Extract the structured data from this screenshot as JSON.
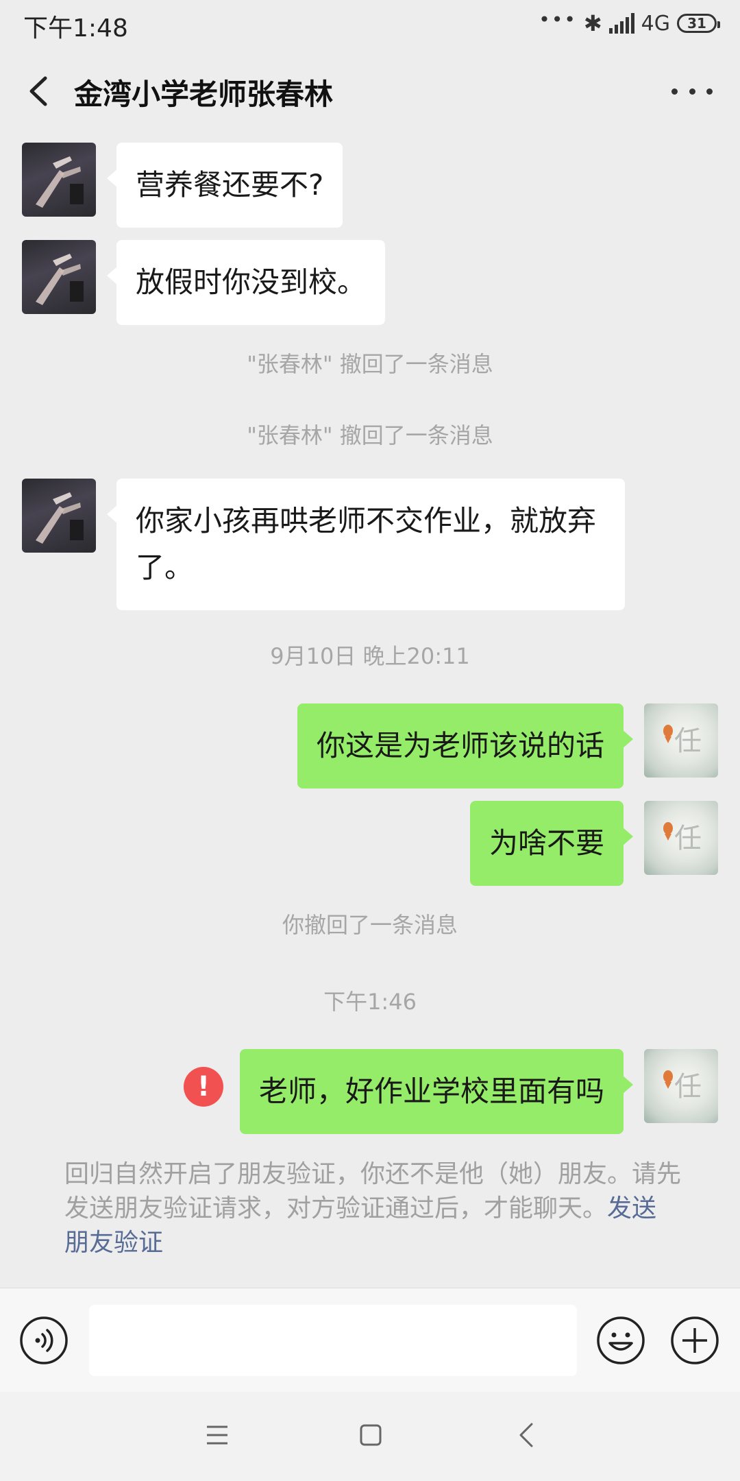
{
  "status_bar": {
    "time": "下午1:48",
    "dots": "•••",
    "network": "4G",
    "battery": "31"
  },
  "header": {
    "title": "金湾小学老师张春林"
  },
  "messages": [
    {
      "text": "营养餐还要不?"
    },
    {
      "text": "放假时你没到校。"
    },
    {
      "text": "\"张春林\" 撤回了一条消息"
    },
    {
      "text": "\"张春林\" 撤回了一条消息"
    },
    {
      "text": "你家小孩再哄老师不交作业，就放弃了。"
    },
    {
      "text": "9月10日 晚上20:11"
    },
    {
      "text": "你这是为老师该说的话"
    },
    {
      "text": "为啥不要"
    },
    {
      "text": "你撤回了一条消息"
    },
    {
      "text": "下午1:46"
    },
    {
      "text": "老师，好作业学校里面有吗"
    }
  ],
  "self_avatar_char": "任",
  "error_mark": "!",
  "notice": {
    "text": "回归自然开启了朋友验证，你还不是他（她）朋友。请先发送朋友验证请求，对方验证通过后，才能聊天。",
    "link": "发送朋友验证"
  },
  "input": {
    "value": "",
    "placeholder": ""
  },
  "colors": {
    "sent_bubble": "#95ec69",
    "received_bubble": "#ffffff",
    "background": "#ededed",
    "link": "#576b95",
    "error": "#f25151"
  }
}
